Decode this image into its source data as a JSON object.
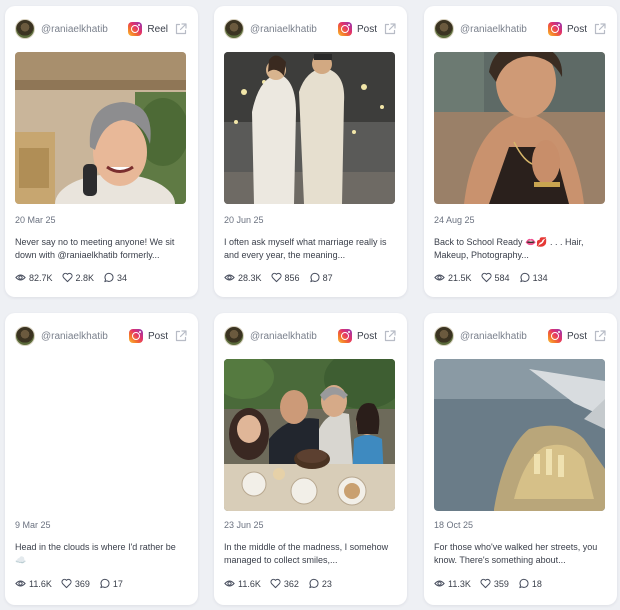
{
  "cards": [
    {
      "handle": "@raniaelkhatib",
      "platform_icon": "instagram-icon",
      "type": "Reel",
      "date": "20 Mar 25",
      "caption": "Never say no to meeting anyone! We sit down with @raniaelkhatib formerly...",
      "views": "82.7K",
      "likes": "2.8K",
      "comments": "34"
    },
    {
      "handle": "@raniaelkhatib",
      "platform_icon": "instagram-icon",
      "type": "Post",
      "date": "20 Jun 25",
      "caption": "I often ask myself what marriage really is and every year, the meaning...",
      "views": "28.3K",
      "likes": "856",
      "comments": "87"
    },
    {
      "handle": "@raniaelkhatib",
      "platform_icon": "instagram-icon",
      "type": "Post",
      "date": "24 Aug 25",
      "caption": "Back to School Ready 👄💋 . . . Hair, Makeup, Photography...",
      "views": "21.5K",
      "likes": "584",
      "comments": "134"
    },
    {
      "handle": "@raniaelkhatib",
      "platform_icon": "instagram-icon",
      "type": "Post",
      "date": "9 Mar 25",
      "caption": "Head in the clouds is where I'd rather be ☁️",
      "views": "11.6K",
      "likes": "369",
      "comments": "17"
    },
    {
      "handle": "@raniaelkhatib",
      "platform_icon": "instagram-icon",
      "type": "Post",
      "date": "23 Jun 25",
      "caption": "In the middle of the madness, I somehow managed to collect smiles,...",
      "views": "11.6K",
      "likes": "362",
      "comments": "23"
    },
    {
      "handle": "@raniaelkhatib",
      "platform_icon": "instagram-icon",
      "type": "Post",
      "date": "18 Oct 25",
      "caption": "For those who've walked her streets, you know. There's something about...",
      "views": "11.3K",
      "likes": "359",
      "comments": "18"
    }
  ]
}
